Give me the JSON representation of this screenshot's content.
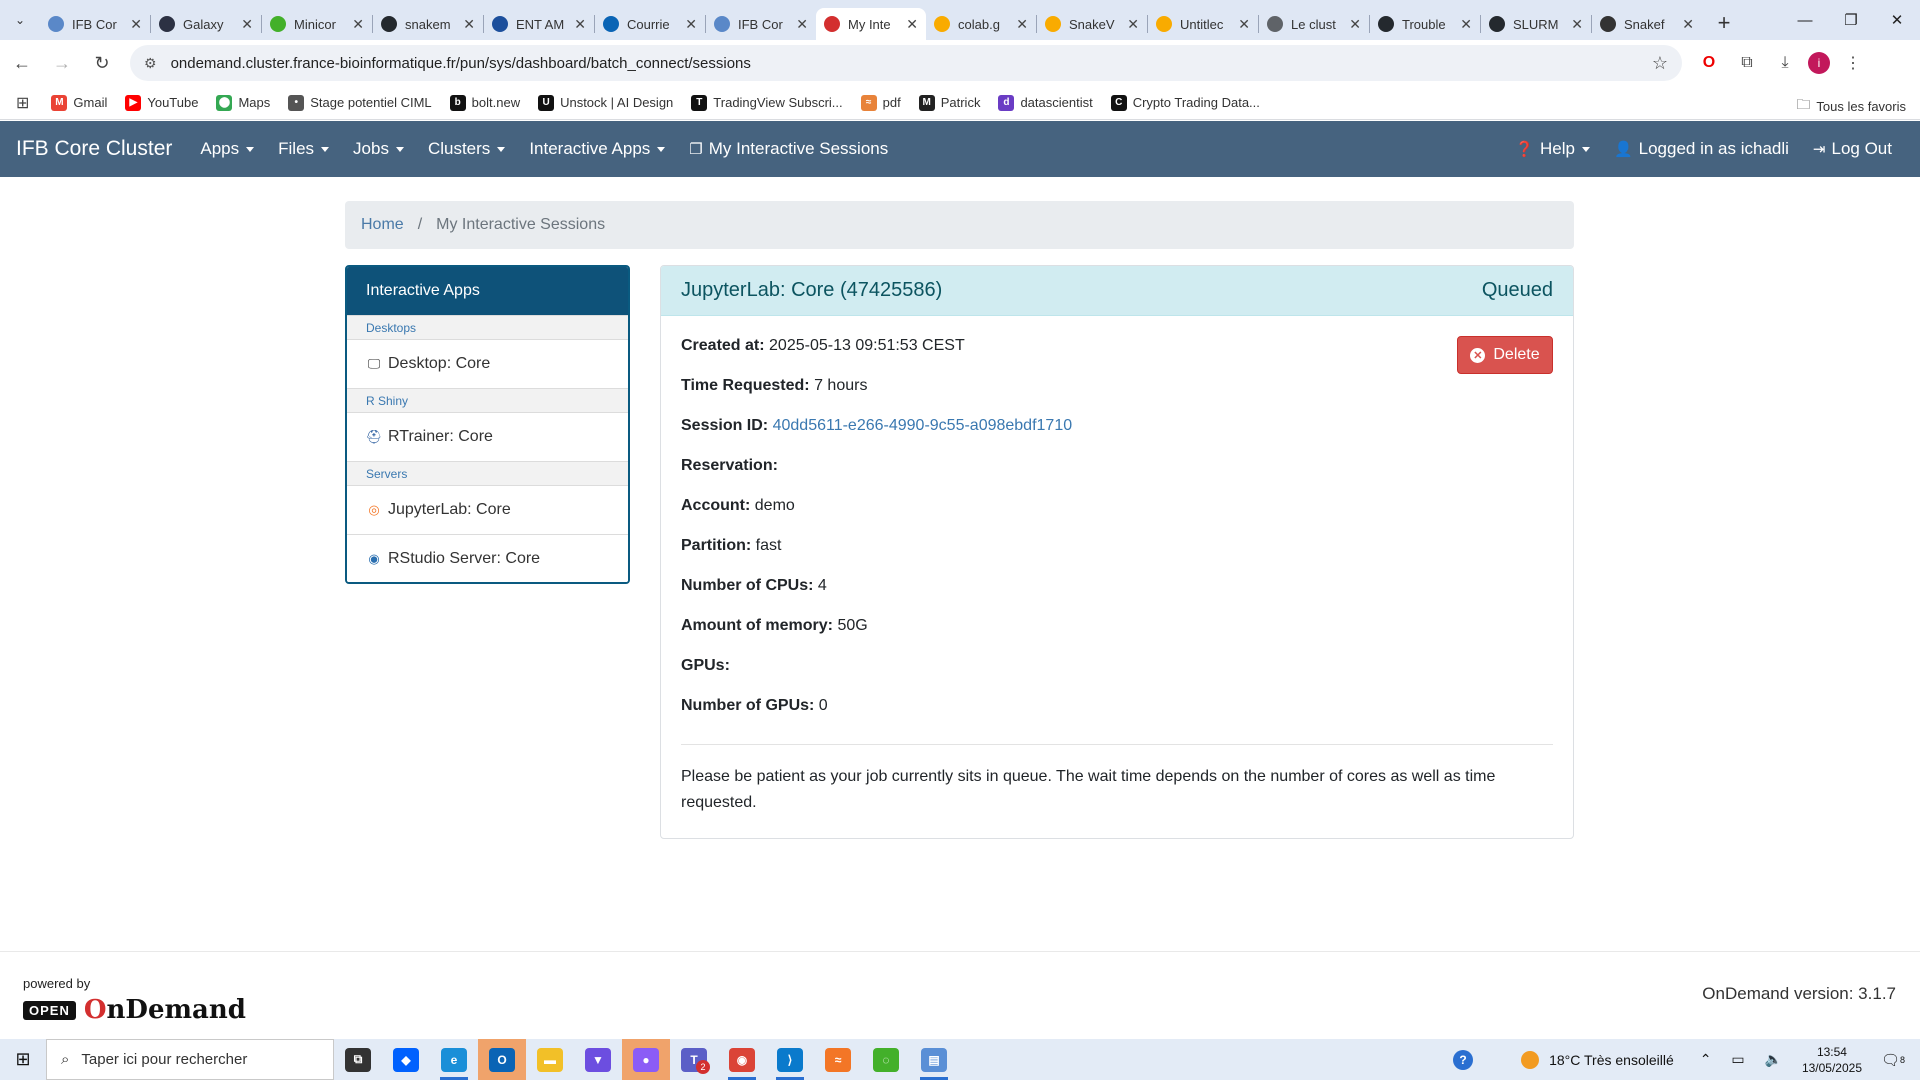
{
  "browser": {
    "tabs": [
      {
        "title": "IFB Cor",
        "icon": "ifb-icon",
        "color": "#5a88c8",
        "active": false
      },
      {
        "title": "Galaxy",
        "icon": "galaxy-icon",
        "color": "#2c3143",
        "active": false
      },
      {
        "title": "Minicor",
        "icon": "miniconda-icon",
        "color": "#43b02a",
        "active": false
      },
      {
        "title": "snakem",
        "icon": "github-icon",
        "color": "#24292e",
        "active": false
      },
      {
        "title": "ENT AM",
        "icon": "ent-icon",
        "color": "#1c4f9c",
        "active": false
      },
      {
        "title": "Courrie",
        "icon": "outlook-icon",
        "color": "#0a64b5",
        "active": false
      },
      {
        "title": "IFB Cor",
        "icon": "ifb-icon",
        "color": "#5a88c8",
        "active": false
      },
      {
        "title": "My Inte",
        "icon": "ondemand-icon",
        "color": "#d32f2f",
        "active": true
      },
      {
        "title": "colab.g",
        "icon": "colab-icon",
        "color": "#f9ab00",
        "active": false
      },
      {
        "title": "SnakeV",
        "icon": "colab-icon",
        "color": "#f9ab00",
        "active": false
      },
      {
        "title": "Untitlec",
        "icon": "colab-icon",
        "color": "#f9ab00",
        "active": false
      },
      {
        "title": "Le clust",
        "icon": "doc-icon",
        "color": "#5f6368",
        "active": false
      },
      {
        "title": "Trouble",
        "icon": "github-icon",
        "color": "#24292e",
        "active": false
      },
      {
        "title": "SLURM",
        "icon": "github-icon",
        "color": "#24292e",
        "active": false
      },
      {
        "title": "Snakef",
        "icon": "chatgpt-icon",
        "color": "#333333",
        "active": false
      }
    ],
    "url": "ondemand.cluster.france-bioinformatique.fr/pun/sys/dashboard/batch_connect/sessions",
    "bookmarks": [
      {
        "label": "Gmail",
        "icon": "gmail-icon",
        "color": "#ea4335",
        "glyph": "M"
      },
      {
        "label": "YouTube",
        "icon": "youtube-icon",
        "color": "#ff0000",
        "glyph": "▶"
      },
      {
        "label": "Maps",
        "icon": "maps-icon",
        "color": "#34a853",
        "glyph": "⬤"
      },
      {
        "label": "Stage potentiel CIML",
        "icon": "ciml-icon",
        "color": "#555555",
        "glyph": "•"
      },
      {
        "label": "bolt.new",
        "icon": "bolt-icon",
        "color": "#111111",
        "glyph": "b"
      },
      {
        "label": "Unstock | AI Design",
        "icon": "unstock-icon",
        "color": "#111111",
        "glyph": "U"
      },
      {
        "label": "TradingView Subscri...",
        "icon": "tradingview-icon",
        "color": "#111111",
        "glyph": "T"
      },
      {
        "label": "pdf",
        "icon": "pdf-icon",
        "color": "#e8833a",
        "glyph": "≈"
      },
      {
        "label": "Patrick",
        "icon": "patrick-icon",
        "color": "#222222",
        "glyph": "M"
      },
      {
        "label": "datascientist",
        "icon": "datascientist-icon",
        "color": "#6a3cc4",
        "glyph": "d"
      },
      {
        "label": "Crypto Trading Data...",
        "icon": "crypto-icon",
        "color": "#111111",
        "glyph": "C"
      }
    ],
    "all_bookmarks": "Tous les favoris"
  },
  "navbar": {
    "brand": "IFB Core Cluster",
    "menus": [
      "Apps",
      "Files",
      "Jobs",
      "Clusters",
      "Interactive Apps"
    ],
    "sessions_link": "My Interactive Sessions",
    "help": "Help",
    "logged_in": "Logged in as ichadli",
    "logout": "Log Out",
    "color": "#46637f"
  },
  "breadcrumb": {
    "home": "Home",
    "separator": "/",
    "current": "My Interactive Sessions"
  },
  "sidebar": {
    "title": "Interactive Apps",
    "groups": [
      {
        "category": "Desktops",
        "items": [
          {
            "label": "Desktop: Core",
            "icon": "monitor-icon"
          }
        ]
      },
      {
        "category": "R Shiny",
        "items": [
          {
            "label": "RTrainer: Core",
            "icon": "rtrainer-icon"
          }
        ]
      },
      {
        "category": "Servers",
        "items": [
          {
            "label": "JupyterLab: Core",
            "icon": "jupyter-icon"
          },
          {
            "label": "RStudio Server: Core",
            "icon": "rstudio-icon"
          }
        ]
      }
    ]
  },
  "session": {
    "title": "JupyterLab: Core (47425586)",
    "status": "Queued",
    "delete_label": "Delete",
    "fields": [
      {
        "label": "Created at:",
        "value": "2025-05-13 09:51:53 CEST",
        "link": false
      },
      {
        "label": "Time Requested:",
        "value": "7 hours",
        "link": false
      },
      {
        "label": "Session ID:",
        "value": "40dd5611-e266-4990-9c55-a098ebdf1710",
        "link": true
      },
      {
        "label": "Reservation:",
        "value": "",
        "link": false
      },
      {
        "label": "Account:",
        "value": "demo",
        "link": false
      },
      {
        "label": "Partition:",
        "value": "fast",
        "link": false
      },
      {
        "label": "Number of CPUs:",
        "value": "4",
        "link": false
      },
      {
        "label": "Amount of memory:",
        "value": "50G",
        "link": false
      },
      {
        "label": "GPUs:",
        "value": "",
        "link": false
      },
      {
        "label": "Number of GPUs:",
        "value": "0",
        "link": false
      }
    ],
    "note": "Please be patient as your job currently sits in queue. The wait time depends on the number of cores as well as time requested."
  },
  "footer": {
    "powered_by": "powered by",
    "logo_open": "OPEN",
    "logo_ondemand_first": "O",
    "logo_ondemand_rest": "nDemand",
    "version": "OnDemand version: 3.1.7"
  },
  "taskbar": {
    "search_placeholder": "Taper ici pour rechercher",
    "apps": [
      {
        "name": "task-view-icon",
        "color": "#333333",
        "glyph": "⧉",
        "hl": false,
        "active": false
      },
      {
        "name": "dropbox-icon",
        "color": "#0061fe",
        "glyph": "◆",
        "hl": false,
        "active": false
      },
      {
        "name": "edge-icon",
        "color": "#1a8fd8",
        "glyph": "e",
        "hl": false,
        "active": true
      },
      {
        "name": "outlook-icon",
        "color": "#0a64b5",
        "glyph": "O",
        "hl": true,
        "active": false
      },
      {
        "name": "file-explorer-icon",
        "color": "#f2c028",
        "glyph": "▬",
        "hl": false,
        "active": false
      },
      {
        "name": "app-icon",
        "color": "#6c4ee0",
        "glyph": "▼",
        "hl": false,
        "active": false
      },
      {
        "name": "messenger-icon",
        "color": "#8b5cf6",
        "glyph": "●",
        "hl": true,
        "active": false
      },
      {
        "name": "teams-icon",
        "color": "#5b5fc7",
        "glyph": "T",
        "hl": false,
        "active": false
      },
      {
        "name": "chrome-icon",
        "color": "#db4437",
        "glyph": "◉",
        "hl": false,
        "active": true
      },
      {
        "name": "vscode-icon",
        "color": "#0a7acc",
        "glyph": "⟩",
        "hl": false,
        "active": true
      },
      {
        "name": "jupyter-icon",
        "color": "#f37626",
        "glyph": "≈",
        "hl": false,
        "active": false
      },
      {
        "name": "miniconda-icon",
        "color": "#43b02a",
        "glyph": "◌",
        "hl": false,
        "active": false
      },
      {
        "name": "notepad-icon",
        "color": "#5a8fd6",
        "glyph": "▤",
        "hl": false,
        "active": true
      }
    ],
    "teams_badge": "2",
    "weather": "18°C  Très ensoleillé",
    "time": "13:54",
    "date": "13/05/2025",
    "notif_count": "8"
  }
}
